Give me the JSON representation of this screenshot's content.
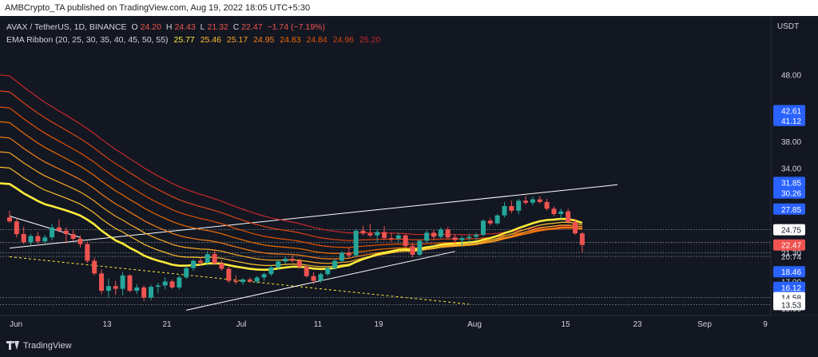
{
  "header": {
    "published_by": "AMBCrypto_TA published on TradingView.com, Aug 19, 2022 18:05 UTC+5:30"
  },
  "legend": {
    "symbol": "AVAX / TetherUS, 1D, BINANCE",
    "open_label": "O",
    "open": "24.20",
    "high_label": "H",
    "high": "24.43",
    "low_label": "L",
    "low": "21.32",
    "close_label": "C",
    "close": "22.47",
    "change": "−1.74 (−7.19%)",
    "ema_title": "EMA Ribbon (20, 25, 30, 35, 40, 45, 50, 55)",
    "ema_values": [
      "25.77",
      "25.46",
      "25.17",
      "24.95",
      "24.83",
      "24.84",
      "24.96",
      "25.20"
    ]
  },
  "currency": "USDT",
  "brand": "TradingView",
  "colors": {
    "background": "#131722",
    "up": "#26a69a",
    "down": "#ef5350",
    "text": "#d1d4dc",
    "label_blue": "#2962ff",
    "ema_fast": "#ffeb3b",
    "ema_slow": "#c62828"
  },
  "chart_data": {
    "type": "candlestick",
    "ylim": [
      12.5,
      52
    ],
    "xlabels": [
      "Jun",
      "13",
      "21",
      "Jul",
      "11",
      "19",
      "Aug",
      "15",
      "23",
      "Sep",
      "9"
    ],
    "y_ticks": [
      "48.00",
      "38.00",
      "34.00",
      "17.00",
      "15.00",
      "13.00"
    ],
    "price_labels": [
      {
        "value": "42.61",
        "style": "blue"
      },
      {
        "value": "41.12",
        "style": "blue"
      },
      {
        "value": "31.85",
        "style": "blue"
      },
      {
        "value": "30.26",
        "style": "blue"
      },
      {
        "value": "27.85",
        "style": "blue"
      },
      {
        "value": "24.75",
        "style": "white"
      },
      {
        "value": "22.83",
        "style": "plain"
      },
      {
        "value": "22.47",
        "style": "red"
      },
      {
        "value": "21.30",
        "style": "plain"
      },
      {
        "value": "20.74",
        "style": "plain"
      },
      {
        "value": "18.46",
        "style": "blue"
      },
      {
        "value": "16.12",
        "style": "blue"
      },
      {
        "value": "14.58",
        "style": "white"
      },
      {
        "value": "13.53",
        "style": "white"
      }
    ],
    "horizontal_levels": [
      24.75,
      22.83,
      21.3,
      20.74,
      14.58,
      13.53
    ],
    "trendlines": [
      {
        "from": [
          "May 30",
          22.0
        ],
        "to": [
          "Aug 24",
          31.5
        ],
        "color": "#ffffff"
      },
      {
        "from": [
          "Jun 24",
          12.7
        ],
        "to": [
          "Aug 1",
          21.5
        ],
        "color": "#ffffff"
      },
      {
        "from": [
          "May 30",
          26.8
        ],
        "to": [
          "Jun 9",
          23.6
        ],
        "color": "#ffffff"
      },
      {
        "from": [
          "May 30",
          20.7
        ],
        "to": [
          "Aug 3",
          13.6
        ],
        "color": "#ffeb3b",
        "dash": true
      }
    ],
    "candles": [
      [
        "May 30",
        26.6,
        27.6,
        25.8,
        26.0
      ],
      [
        "May 31",
        26.0,
        26.5,
        23.6,
        24.1
      ],
      [
        "Jun 1",
        24.1,
        25.2,
        22.6,
        22.9
      ],
      [
        "Jun 2",
        22.9,
        24.1,
        22.4,
        23.8
      ],
      [
        "Jun 3",
        23.8,
        24.4,
        22.6,
        23.0
      ],
      [
        "Jun 4",
        23.0,
        24.0,
        22.7,
        23.6
      ],
      [
        "Jun 5",
        23.6,
        25.6,
        23.2,
        25.1
      ],
      [
        "Jun 6",
        25.1,
        26.3,
        24.4,
        24.6
      ],
      [
        "Jun 7",
        24.6,
        25.1,
        22.7,
        24.1
      ],
      [
        "Jun 8",
        24.1,
        24.7,
        23.1,
        23.4
      ],
      [
        "Jun 9",
        23.4,
        23.9,
        22.1,
        22.6
      ],
      [
        "Jun 10",
        22.6,
        23.0,
        19.8,
        20.1
      ],
      [
        "Jun 11",
        20.1,
        20.6,
        17.9,
        18.2
      ],
      [
        "Jun 12",
        18.2,
        18.8,
        15.1,
        15.6
      ],
      [
        "Jun 13",
        15.6,
        17.4,
        14.6,
        16.3
      ],
      [
        "Jun 14",
        16.3,
        17.1,
        15.0,
        15.9
      ],
      [
        "Jun 15",
        15.9,
        18.4,
        14.9,
        17.9
      ],
      [
        "Jun 16",
        17.9,
        18.1,
        15.4,
        15.6
      ],
      [
        "Jun 17",
        15.6,
        16.6,
        15.1,
        16.1
      ],
      [
        "Jun 18",
        16.1,
        16.4,
        14.1,
        14.6
      ],
      [
        "Jun 19",
        14.6,
        16.5,
        14.2,
        16.2
      ],
      [
        "Jun 20",
        16.2,
        16.8,
        15.2,
        16.4
      ],
      [
        "Jun 21",
        16.4,
        17.6,
        15.8,
        17.0
      ],
      [
        "Jun 22",
        17.0,
        17.3,
        15.9,
        16.1
      ],
      [
        "Jun 23",
        16.1,
        17.9,
        15.8,
        17.6
      ],
      [
        "Jun 24",
        17.6,
        19.3,
        17.4,
        19.0
      ],
      [
        "Jun 25",
        19.0,
        20.3,
        18.6,
        20.1
      ],
      [
        "Jun 26",
        20.1,
        20.7,
        19.4,
        19.8
      ],
      [
        "Jun 27",
        19.8,
        21.6,
        19.4,
        21.1
      ],
      [
        "Jun 28",
        21.1,
        21.7,
        19.5,
        19.7
      ],
      [
        "Jun 29",
        19.7,
        20.2,
        18.6,
        18.9
      ],
      [
        "Jun 30",
        18.9,
        19.2,
        16.8,
        17.1
      ],
      [
        "Jul 1",
        17.1,
        17.9,
        16.6,
        16.9
      ],
      [
        "Jul 2",
        16.9,
        17.5,
        16.5,
        17.3
      ],
      [
        "Jul 3",
        17.3,
        17.6,
        16.8,
        17.0
      ],
      [
        "Jul 4",
        17.0,
        17.8,
        16.7,
        17.6
      ],
      [
        "Jul 5",
        17.6,
        18.3,
        17.1,
        18.1
      ],
      [
        "Jul 6",
        18.1,
        19.4,
        17.8,
        19.1
      ],
      [
        "Jul 7",
        19.1,
        20.3,
        18.8,
        20.0
      ],
      [
        "Jul 8",
        20.0,
        20.8,
        19.6,
        20.4
      ],
      [
        "Jul 9",
        20.4,
        20.9,
        19.8,
        20.1
      ],
      [
        "Jul 10",
        20.1,
        20.4,
        18.9,
        19.2
      ],
      [
        "Jul 11",
        19.2,
        19.5,
        17.6,
        17.8
      ],
      [
        "Jul 12",
        17.8,
        18.4,
        16.6,
        17.1
      ],
      [
        "Jul 13",
        17.1,
        18.3,
        16.8,
        18.1
      ],
      [
        "Jul 14",
        18.1,
        19.2,
        17.8,
        19.0
      ],
      [
        "Jul 15",
        19.0,
        20.4,
        18.8,
        20.1
      ],
      [
        "Jul 16",
        20.1,
        21.6,
        19.8,
        21.3
      ],
      [
        "Jul 17",
        21.3,
        22.1,
        20.6,
        20.9
      ],
      [
        "Jul 18",
        20.9,
        24.9,
        20.6,
        24.6
      ],
      [
        "Jul 19",
        24.6,
        25.3,
        23.9,
        24.2
      ],
      [
        "Jul 20",
        24.2,
        25.6,
        23.6,
        23.9
      ],
      [
        "Jul 21",
        23.9,
        24.8,
        22.9,
        24.4
      ],
      [
        "Jul 22",
        24.4,
        25.3,
        23.2,
        23.5
      ],
      [
        "Jul 23",
        23.5,
        24.3,
        22.9,
        23.4
      ],
      [
        "Jul 24",
        23.4,
        24.3,
        22.9,
        23.9
      ],
      [
        "Jul 25",
        23.9,
        24.1,
        22.1,
        22.3
      ],
      [
        "Jul 26",
        22.3,
        22.8,
        20.6,
        21.0
      ],
      [
        "Jul 27",
        21.0,
        23.3,
        20.8,
        23.1
      ],
      [
        "Jul 28",
        23.1,
        24.7,
        22.8,
        24.3
      ],
      [
        "Jul 29",
        24.3,
        24.8,
        23.2,
        23.7
      ],
      [
        "Jul 30",
        23.7,
        25.1,
        23.4,
        24.8
      ],
      [
        "Jul 31",
        24.8,
        25.2,
        23.4,
        23.6
      ],
      [
        "Aug 1",
        23.6,
        24.1,
        22.6,
        23.2
      ],
      [
        "Aug 2",
        23.2,
        23.8,
        22.3,
        23.5
      ],
      [
        "Aug 3",
        23.5,
        24.2,
        22.9,
        23.7
      ],
      [
        "Aug 4",
        23.7,
        24.3,
        23.1,
        24.0
      ],
      [
        "Aug 5",
        24.0,
        26.3,
        23.8,
        26.1
      ],
      [
        "Aug 6",
        26.1,
        26.5,
        25.4,
        25.7
      ],
      [
        "Aug 7",
        25.7,
        27.1,
        25.5,
        26.9
      ],
      [
        "Aug 8",
        26.9,
        28.9,
        26.6,
        28.3
      ],
      [
        "Aug 9",
        28.3,
        29.1,
        27.2,
        27.6
      ],
      [
        "Aug 10",
        27.6,
        29.4,
        27.1,
        29.1
      ],
      [
        "Aug 11",
        29.1,
        29.8,
        28.5,
        28.8
      ],
      [
        "Aug 12",
        28.8,
        29.7,
        28.4,
        29.3
      ],
      [
        "Aug 13",
        29.3,
        29.8,
        28.7,
        28.9
      ],
      [
        "Aug 14",
        28.9,
        29.4,
        27.6,
        27.9
      ],
      [
        "Aug 15",
        27.9,
        28.3,
        26.8,
        27.1
      ],
      [
        "Aug 16",
        27.1,
        27.9,
        26.4,
        27.5
      ],
      [
        "Aug 17",
        27.5,
        27.9,
        25.7,
        25.9
      ],
      [
        "Aug 18",
        25.9,
        26.4,
        24.0,
        24.2
      ],
      [
        "Aug 19",
        24.2,
        24.43,
        21.32,
        22.47
      ]
    ],
    "ema_ribbon": [
      {
        "name": "EMA 20",
        "color": "#ffeb3b",
        "width": 2.6,
        "start": 31.6,
        "end": 25.77
      },
      {
        "name": "EMA 25",
        "color": "#fbc02d",
        "width": 1.2,
        "start": 34.0,
        "end": 25.46
      },
      {
        "name": "EMA 30",
        "color": "#f9a825",
        "width": 1.2,
        "start": 36.3,
        "end": 25.17
      },
      {
        "name": "EMA 35",
        "color": "#f57f17",
        "width": 1.2,
        "start": 38.5,
        "end": 24.95
      },
      {
        "name": "EMA 40",
        "color": "#ef6c00",
        "width": 1.2,
        "start": 40.8,
        "end": 24.83
      },
      {
        "name": "EMA 45",
        "color": "#e65100",
        "width": 1.2,
        "start": 43.0,
        "end": 24.84
      },
      {
        "name": "EMA 50",
        "color": "#d84315",
        "width": 1.2,
        "start": 45.4,
        "end": 24.96
      },
      {
        "name": "EMA 55",
        "color": "#c62828",
        "width": 1.2,
        "start": 47.8,
        "end": 25.2
      }
    ]
  }
}
